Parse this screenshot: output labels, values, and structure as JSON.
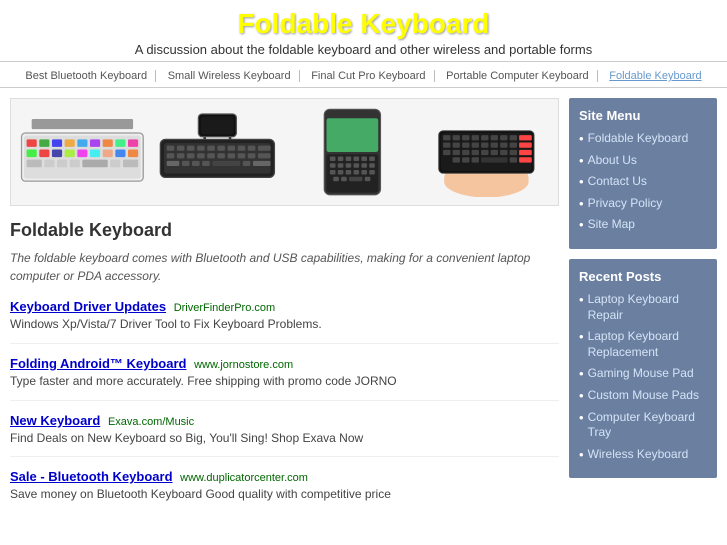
{
  "header": {
    "title": "Foldable Keyboard",
    "tagline": "A discussion about the foldable keyboard and other wireless and portable forms"
  },
  "navbar": {
    "links": [
      {
        "label": "Best Bluetooth Keyboard",
        "active": false
      },
      {
        "label": "Small Wireless Keyboard",
        "active": false
      },
      {
        "label": "Final Cut Pro Keyboard",
        "active": false
      },
      {
        "label": "Portable Computer Keyboard",
        "active": false
      },
      {
        "label": "Foldable Keyboard",
        "active": true
      }
    ]
  },
  "article": {
    "title": "Foldable Keyboard",
    "description": "The foldable keyboard comes with Bluetooth and USB capabilities, making for a convenient laptop computer or PDA accessory."
  },
  "ads": [
    {
      "title": "Keyboard Driver Updates",
      "source": "DriverFinderPro.com",
      "desc": "Windows Xp/Vista/7 Driver Tool to Fix Keyboard Problems."
    },
    {
      "title": "Folding Android™ Keyboard",
      "source": "www.jornostore.com",
      "desc": "Type faster and more accurately. Free shipping with promo code JORNO"
    },
    {
      "title": "New Keyboard",
      "source": "Exava.com/Music",
      "desc": "Find Deals on New Keyboard so Big, You'll Sing! Shop Exava Now"
    },
    {
      "title": "Sale - Bluetooth Keyboard",
      "source": "www.duplicatorcenter.com",
      "desc": "Save money on Bluetooth Keyboard Good quality with competitive price"
    }
  ],
  "sidebar": {
    "menu_title": "Site Menu",
    "menu_items": [
      {
        "label": "Foldable Keyboard"
      },
      {
        "label": "About Us"
      },
      {
        "label": "Contact Us"
      },
      {
        "label": "Privacy Policy"
      },
      {
        "label": "Site Map"
      }
    ],
    "recent_title": "Recent Posts",
    "recent_items": [
      {
        "label": "Laptop Keyboard Repair"
      },
      {
        "label": "Laptop Keyboard Replacement"
      },
      {
        "label": "Gaming Mouse Pad"
      },
      {
        "label": "Custom Mouse Pads"
      },
      {
        "label": "Computer Keyboard Tray"
      },
      {
        "label": "Wireless Keyboard"
      }
    ]
  }
}
